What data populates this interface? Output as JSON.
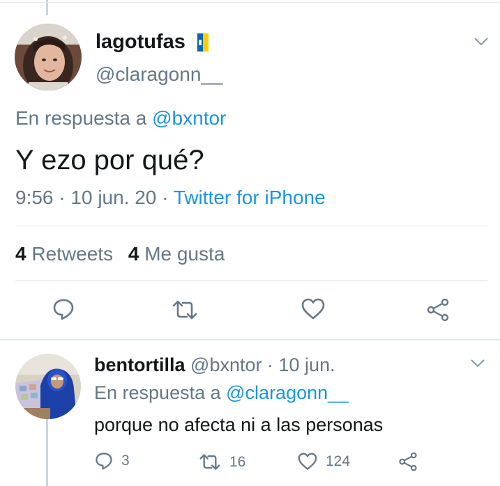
{
  "main_tweet": {
    "display_name": "lagotufas",
    "flag_emoji": "🇮🇨",
    "handle": "@claragonn__",
    "reply_to_prefix": "En respuesta a",
    "reply_to_handle": "@bxntor",
    "text": "Y ezo por qué?",
    "time": "9:56",
    "date": "10 jun. 20",
    "separator": "·",
    "source": "Twitter for iPhone",
    "stats": {
      "retweets_count": "4",
      "retweets_label": "Retweets",
      "likes_count": "4",
      "likes_label": "Me gusta"
    },
    "actions": {
      "reply_icon": "reply-icon",
      "retweet_icon": "retweet-icon",
      "like_icon": "heart-icon",
      "share_icon": "share-icon"
    }
  },
  "reply_tweet": {
    "display_name": "bentortilla",
    "handle": "@bxntor",
    "separator": "·",
    "date": "10 jun.",
    "reply_to_prefix": "En respuesta a",
    "reply_to_handle": "@claragonn__",
    "text": "porque no afecta ni a las personas",
    "replies": "3",
    "retweets": "16",
    "likes": "124"
  },
  "colors": {
    "accent_blue": "#1b95e0",
    "secondary_gray": "#657786",
    "divider": "#e1e8ed",
    "thread_line": "#cdd5dc"
  }
}
